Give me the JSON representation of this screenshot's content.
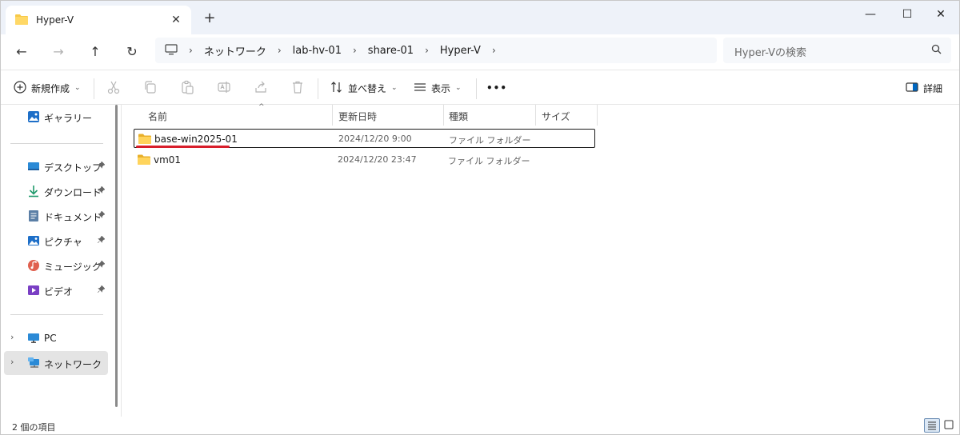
{
  "tab": {
    "title": "Hyper-V",
    "close": "✕",
    "new": "+"
  },
  "window": {
    "minimize": "—",
    "maximize": "☐",
    "close": "✕"
  },
  "nav": {
    "back": "←",
    "forward": "→",
    "up": "↑",
    "refresh": "↻"
  },
  "breadcrumbs": [
    "ネットワーク",
    "lab-hv-01",
    "share-01",
    "Hyper-V"
  ],
  "breadcrumb_separator": "›",
  "search": {
    "placeholder": "Hyper-Vの検索"
  },
  "commands": {
    "new": "新規作成",
    "sort": "並べ替え",
    "view": "表示",
    "more": "•••",
    "details": "詳細",
    "caret": "⌄"
  },
  "sidebar": {
    "gallery": "ギャラリー",
    "quick": [
      {
        "label": "デスクトップ",
        "icon": "desktop-icon"
      },
      {
        "label": "ダウンロード",
        "icon": "download-icon"
      },
      {
        "label": "ドキュメント",
        "icon": "documents-icon"
      },
      {
        "label": "ピクチャ",
        "icon": "pictures-icon"
      },
      {
        "label": "ミュージック",
        "icon": "music-icon"
      },
      {
        "label": "ビデオ",
        "icon": "videos-icon"
      }
    ],
    "pin": "📌",
    "pc": "PC",
    "network": "ネットワーク",
    "chevron": "›"
  },
  "columns": {
    "name": "名前",
    "modified": "更新日時",
    "type": "種類",
    "size": "サイズ",
    "sort_indicator": "^"
  },
  "files": [
    {
      "name": "base-win2025-01",
      "modified": "2024/12/20 9:00",
      "type": "ファイル フォルダー"
    },
    {
      "name": "vm01",
      "modified": "2024/12/20 23:47",
      "type": "ファイル フォルダー"
    }
  ],
  "status": {
    "count": "2 個の項目"
  },
  "colors": {
    "accent": "#0067c0",
    "folder": "#f7c948",
    "annotation": "#d81e2b"
  }
}
